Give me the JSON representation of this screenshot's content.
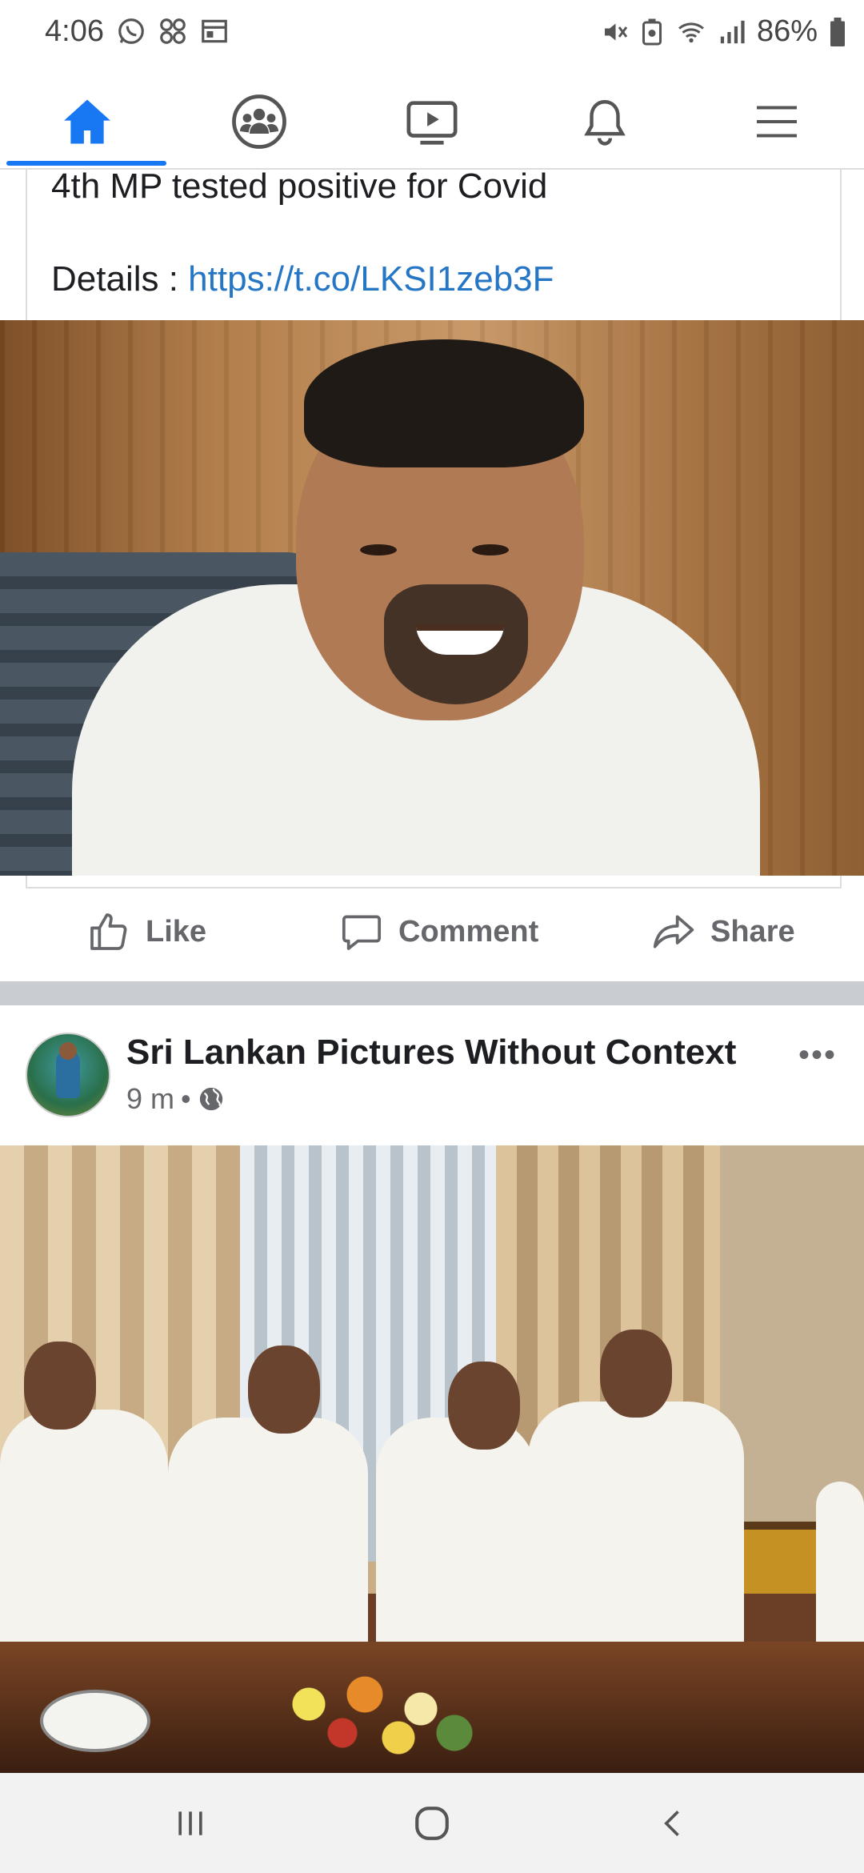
{
  "status_bar": {
    "time": "4:06",
    "battery": "86%",
    "left_icons": [
      "whatsapp-icon",
      "app-grid-icon",
      "calendar-icon"
    ],
    "right_icons": [
      "mute-icon",
      "battery-saver-icon",
      "wifi-icon",
      "signal-icon",
      "battery-icon"
    ]
  },
  "nav": {
    "tabs": [
      {
        "name": "home",
        "icon": "home-icon",
        "active": true
      },
      {
        "name": "groups",
        "icon": "groups-icon",
        "active": false
      },
      {
        "name": "watch",
        "icon": "video-icon",
        "active": false
      },
      {
        "name": "notifications",
        "icon": "bell-icon",
        "active": false
      },
      {
        "name": "menu",
        "icon": "hamburger-menu-icon",
        "active": false
      }
    ],
    "accent": "#1877f2"
  },
  "post1": {
    "text": "4th MP tested positive for Covid",
    "details_label": "Details : ",
    "link": "https://t.co/LKSI1zeb3F",
    "link_color": "#2676c6"
  },
  "actions": {
    "like": "Like",
    "comment": "Comment",
    "share": "Share"
  },
  "post2": {
    "page_name": "Sri Lankan Pictures Without Context",
    "time": "9 m",
    "separator": "•",
    "more": "•••"
  }
}
